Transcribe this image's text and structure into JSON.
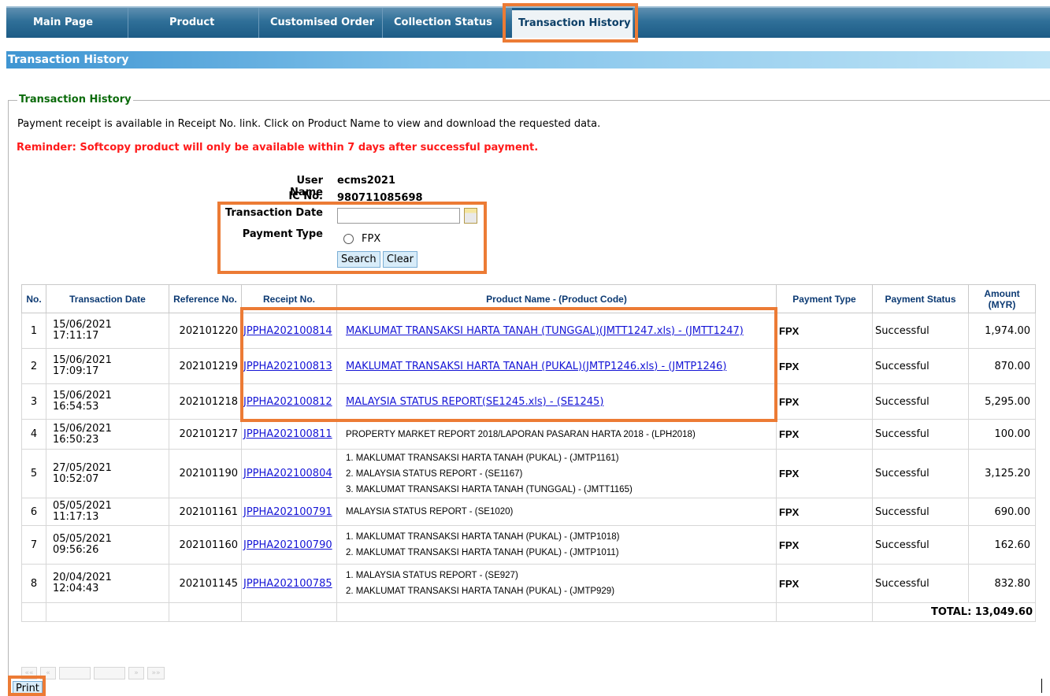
{
  "nav": {
    "tabs": [
      {
        "label": "Main Page"
      },
      {
        "label": "Product"
      },
      {
        "label": "Customised Order"
      },
      {
        "label": "Collection Status"
      },
      {
        "label": "Transaction History",
        "active": true
      }
    ]
  },
  "section_title": "Transaction History",
  "legend": "Transaction History",
  "info_text": "Payment receipt is available in Receipt No. link. Click on Product Name to view and download the requested data.",
  "reminder_text": "Reminder: Softcopy product will only be available within 7 days after successful payment.",
  "form": {
    "user_name_label": "User Name",
    "user_name": "ecms2021",
    "ic_label": "IC No.",
    "ic_value": "980711085698",
    "date_label": "Transaction Date",
    "date_value": "",
    "payment_type_label": "Payment Type",
    "payment_option": "FPX",
    "search_label": "Search",
    "clear_label": "Clear"
  },
  "table": {
    "headers": [
      "No.",
      "Transaction Date",
      "Reference No.",
      "Receipt No.",
      "Product Name - (Product Code)",
      "Payment Type",
      "Payment Status",
      "Amount (MYR)"
    ],
    "rows": [
      {
        "no": "1",
        "date": "15/06/2021",
        "time": "17:11:17",
        "ref": "202101220",
        "receipt": "JPPHA202100814",
        "products": [
          "MAKLUMAT TRANSAKSI HARTA TANAH (TUNGGAL)(JMTT1247.xls) - (JMTT1247)"
        ],
        "linked": true,
        "payment_type": "FPX",
        "status": "Successful",
        "amount": "1,974.00"
      },
      {
        "no": "2",
        "date": "15/06/2021",
        "time": "17:09:17",
        "ref": "202101219",
        "receipt": "JPPHA202100813",
        "products": [
          "MAKLUMAT TRANSAKSI HARTA TANAH (PUKAL)(JMTP1246.xls) - (JMTP1246)"
        ],
        "linked": true,
        "payment_type": "FPX",
        "status": "Successful",
        "amount": "870.00"
      },
      {
        "no": "3",
        "date": "15/06/2021",
        "time": "16:54:53",
        "ref": "202101218",
        "receipt": "JPPHA202100812",
        "products": [
          "MALAYSIA STATUS REPORT(SE1245.xls) - (SE1245)"
        ],
        "linked": true,
        "payment_type": "FPX",
        "status": "Successful",
        "amount": "5,295.00"
      },
      {
        "no": "4",
        "date": "15/06/2021",
        "time": "16:50:23",
        "ref": "202101217",
        "receipt": "JPPHA202100811",
        "products": [
          "PROPERTY MARKET REPORT 2018/LAPORAN PASARAN HARTA 2018 - (LPH2018)"
        ],
        "linked": false,
        "payment_type": "FPX",
        "status": "Successful",
        "amount": "100.00"
      },
      {
        "no": "5",
        "date": "27/05/2021",
        "time": "10:52:07",
        "ref": "202101190",
        "receipt": "JPPHA202100804",
        "products": [
          "1.  MAKLUMAT TRANSAKSI HARTA TANAH (PUKAL) - (JMTP1161)",
          "2.  MALAYSIA STATUS REPORT - (SE1167)",
          "3.  MAKLUMAT TRANSAKSI HARTA TANAH (TUNGGAL) - (JMTT1165)"
        ],
        "linked": false,
        "payment_type": "FPX",
        "status": "Successful",
        "amount": "3,125.20"
      },
      {
        "no": "6",
        "date": "05/05/2021",
        "time": "11:17:13",
        "ref": "202101161",
        "receipt": "JPPHA202100791",
        "products": [
          "MALAYSIA STATUS REPORT - (SE1020)"
        ],
        "linked": false,
        "payment_type": "FPX",
        "status": "Successful",
        "amount": "690.00"
      },
      {
        "no": "7",
        "date": "05/05/2021",
        "time": "09:56:26",
        "ref": "202101160",
        "receipt": "JPPHA202100790",
        "products": [
          "1.  MAKLUMAT TRANSAKSI HARTA TANAH (PUKAL) - (JMTP1018)",
          "2.  MAKLUMAT TRANSAKSI HARTA TANAH (PUKAL) - (JMTP1011)"
        ],
        "linked": false,
        "payment_type": "FPX",
        "status": "Successful",
        "amount": "162.60"
      },
      {
        "no": "8",
        "date": "20/04/2021",
        "time": "12:04:43",
        "ref": "202101145",
        "receipt": "JPPHA202100785",
        "products": [
          "1.  MALAYSIA STATUS REPORT - (SE927)",
          "2.  MAKLUMAT TRANSAKSI HARTA TANAH (PUKAL) - (JMTP929)"
        ],
        "linked": false,
        "payment_type": "FPX",
        "status": "Successful",
        "amount": "832.80"
      }
    ],
    "total": "TOTAL: 13,049.60"
  },
  "pager": {
    "first": "««",
    "prev": "«",
    "next": "»",
    "last": "»»"
  },
  "print_label": "Print",
  "colors": {
    "highlight": "#ec7b35",
    "nav": "#1d5c86",
    "link": "#1515d6",
    "reminder": "#ff1a1a",
    "legend": "#0b6b0b"
  }
}
